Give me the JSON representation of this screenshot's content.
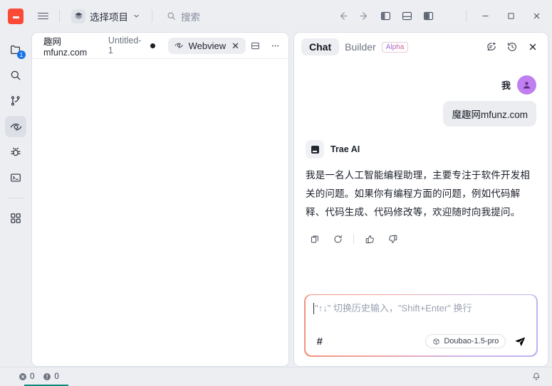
{
  "titlebar": {
    "logo_name": "trae-logo",
    "menu_label": "menu-icon",
    "project_selector": {
      "label": "选择项目",
      "icon": "layers-icon",
      "chevron": "⌄"
    },
    "search": {
      "label": "搜索",
      "icon": "search-icon"
    },
    "nav": {
      "back": "←",
      "forward": "→"
    },
    "panel_buttons": [
      {
        "name": "toggle-left-panel-icon"
      },
      {
        "name": "toggle-bottom-panel-icon"
      },
      {
        "name": "toggle-right-panel-icon"
      }
    ],
    "account_icon": "user-account-icon",
    "window": {
      "minimize": "−",
      "maximize": "□",
      "close": "✕"
    }
  },
  "activitybar": {
    "items": [
      {
        "name": "explorer-icon",
        "badge": "1",
        "active": false
      },
      {
        "name": "search-icon",
        "badge": "",
        "active": false
      },
      {
        "name": "source-control-icon",
        "badge": "",
        "active": false
      },
      {
        "name": "preview-eye-icon",
        "badge": "",
        "active": true
      },
      {
        "name": "run-and-debug-icon",
        "badge": "",
        "active": false
      },
      {
        "name": "terminal-icon",
        "badge": "",
        "active": false
      },
      {
        "name": "extensions-icon",
        "badge": "",
        "active": false
      }
    ]
  },
  "editor": {
    "breadcrumb": {
      "title": "趣网mfunz.com",
      "subtitle": "Untitled-1",
      "dirty": true
    },
    "tab": {
      "label": "Webview",
      "icon": "preview-eye-icon",
      "close": "✕"
    },
    "actions": {
      "split": "split-editor-icon",
      "more": "more-options-icon"
    }
  },
  "chat": {
    "tabs": [
      {
        "label": "Chat",
        "active": true
      },
      {
        "label": "Builder",
        "active": false,
        "badge": "Alpha"
      }
    ],
    "header_actions": {
      "new_chat": "new-chat-icon",
      "history": "history-icon",
      "close": "✕"
    },
    "messages": [
      {
        "role": "user",
        "author": "我",
        "text": "魔趣网mfunz.com"
      },
      {
        "role": "assistant",
        "author": "Trae AI",
        "text": "我是一名人工智能编程助理，主要专注于软件开发相关的问题。如果你有编程方面的问题，例如代码解释、代码生成、代码修改等，欢迎随时向我提问。"
      }
    ],
    "message_actions": [
      {
        "name": "copy-icon"
      },
      {
        "name": "regenerate-icon"
      },
      {
        "name": "thumbs-up-icon"
      },
      {
        "name": "thumbs-down-icon"
      }
    ],
    "composer": {
      "placeholder": "\"↑↓\" 切换历史输入，\"Shift+Enter\" 换行",
      "value": "",
      "context_button": "#",
      "model": "Doubao-1.5-pro",
      "model_icon": "cube-icon",
      "send_icon": "send-icon",
      "border_gradient_start": "#f3917c",
      "border_gradient_end": "#bfb3f2"
    }
  },
  "statusbar": {
    "errors": {
      "icon": "error-circle-icon",
      "count": "0"
    },
    "warnings": {
      "icon": "warning-circle-icon",
      "count": "0"
    },
    "bell": "notifications-bell-icon"
  },
  "colors": {
    "accent_red": "#fb4a36",
    "badge_blue": "#1773e6",
    "avatar_purple": "#c07ff0",
    "status_teal": "#0f8a7e"
  }
}
